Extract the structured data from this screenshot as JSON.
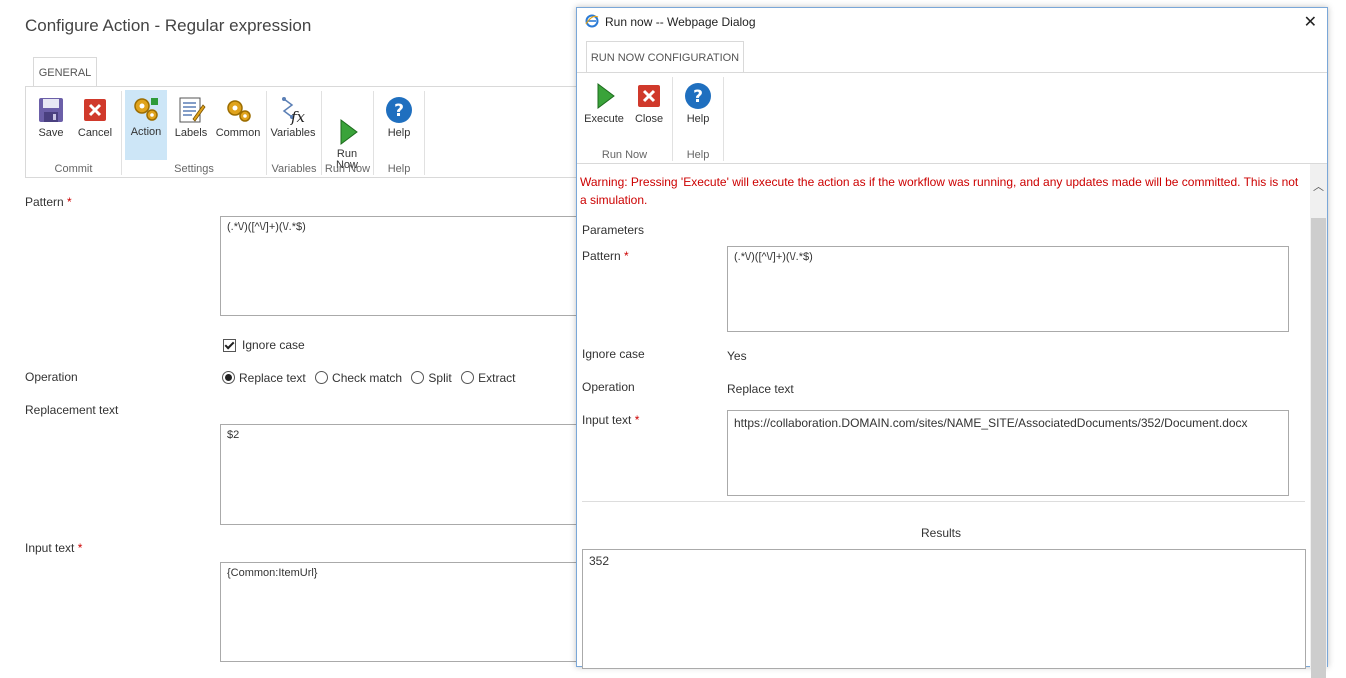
{
  "main": {
    "title": "Configure Action - Regular expression",
    "tab": "GENERAL",
    "ribbon": {
      "buttons": [
        {
          "label": "Save",
          "icon": "save-icon"
        },
        {
          "label": "Cancel",
          "icon": "cancel-icon"
        },
        {
          "label": "Action",
          "icon": "gear-icon"
        },
        {
          "label": "Labels",
          "icon": "labels-icon"
        },
        {
          "label": "Common",
          "icon": "common-gear-icon"
        },
        {
          "label": "Variables",
          "icon": "variables-fx-icon"
        },
        {
          "label": "Run\nNow",
          "icon": "play-icon"
        },
        {
          "label": "Help",
          "icon": "help-icon"
        }
      ],
      "groups": [
        "Commit",
        "Settings",
        "Variables",
        "Run Now",
        "Help"
      ]
    },
    "pattern_label": "Pattern",
    "pattern_value": "(.*\\/)([^\\/]+)(\\/.*$)",
    "ignore_case_label": "Ignore case",
    "operation_label": "Operation",
    "operations": [
      "Replace text",
      "Check match",
      "Split",
      "Extract"
    ],
    "replacement_label": "Replacement text",
    "replacement_value": "$2",
    "input_label": "Input text",
    "input_value": "{Common:ItemUrl}",
    "required_mark": "*"
  },
  "dialog": {
    "title": "Run now -- Webpage Dialog",
    "close_glyph": "✕",
    "tab": "RUN NOW CONFIGURATION",
    "ribbon": {
      "buttons": [
        {
          "label": "Execute",
          "icon": "play-icon"
        },
        {
          "label": "Close",
          "icon": "close-icon"
        },
        {
          "label": "Help",
          "icon": "help-icon"
        }
      ],
      "groups": [
        "Run Now",
        "Help"
      ]
    },
    "warning": "Warning: Pressing 'Execute' will execute the action as if the workflow was running, and any updates made will be committed. This is not a simulation.",
    "parameters_label": "Parameters",
    "pattern_label": "Pattern",
    "pattern_value": "(.*\\/)([^\\/]+)(\\/.*$)",
    "ignore_case_label": "Ignore case",
    "ignore_case_value": "Yes",
    "operation_label": "Operation",
    "operation_value": "Replace text",
    "input_label": "Input text",
    "input_value": "https://collaboration.DOMAIN.com/sites/NAME_SITE/AssociatedDocuments/352/Document.docx",
    "results_label": "Results",
    "results_value": "352",
    "required_mark": "*"
  },
  "colors": {
    "accent_selected": "#cde6f7",
    "required": "#cc0000",
    "dialog_border": "#7aa7d8"
  }
}
